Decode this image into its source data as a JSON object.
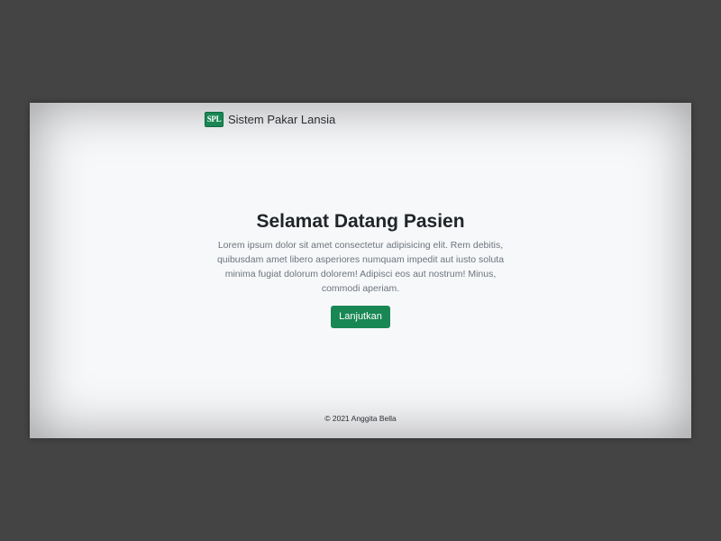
{
  "navbar": {
    "logo_text": "SPL",
    "brand_name": "Sistem Pakar Lansia",
    "accent_color": "#198754"
  },
  "hero": {
    "title": "Selamat Datang Pasien",
    "description": "Lorem ipsum dolor sit amet consectetur adipisicing elit. Rem debitis, quibusdam amet libero asperiores numquam impedit aut iusto soluta minima fugiat dolorum dolorem! Adipisci eos aut nostrum! Minus, commodi aperiam.",
    "button_label": "Lanjutkan"
  },
  "footer": {
    "copyright": "© 2021 Anggita Bella"
  }
}
